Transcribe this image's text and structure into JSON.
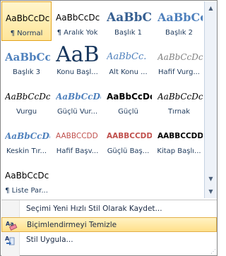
{
  "styles": [
    {
      "sample": "AaBbCcDc",
      "caption": "¶ Normal",
      "color": "#000000",
      "font": "sans",
      "size": 12,
      "weight": "normal",
      "italic": false,
      "selected": true
    },
    {
      "sample": "AaBbCcDc",
      "caption": "¶ Aralık Yok",
      "color": "#000000",
      "font": "sans",
      "size": 12,
      "weight": "normal",
      "italic": false,
      "selected": false
    },
    {
      "sample": "AaBbC",
      "caption": "Başlık 1",
      "color": "#365f91",
      "font": "serif",
      "size": 17,
      "weight": "bold",
      "italic": false,
      "selected": false
    },
    {
      "sample": "AaBbCc",
      "caption": "Başlık 2",
      "color": "#4f81bd",
      "font": "serif",
      "size": 16,
      "weight": "bold",
      "italic": false,
      "selected": false
    },
    {
      "sample": "AaBbCcI",
      "caption": "Başlık 3",
      "color": "#4f81bd",
      "font": "serif",
      "size": 15,
      "weight": "bold",
      "italic": false,
      "selected": false
    },
    {
      "sample": "AaB",
      "caption": "Konu Başl...",
      "color": "#17365d",
      "font": "serif",
      "size": 30,
      "weight": "normal",
      "italic": false,
      "selected": false
    },
    {
      "sample": "AaBbCc.",
      "caption": "Alt Konu ...",
      "color": "#4f81bd",
      "font": "serif",
      "size": 13,
      "weight": "normal",
      "italic": true,
      "selected": false
    },
    {
      "sample": "AaBbCcDc",
      "caption": "Hafif Vurg...",
      "color": "#808080",
      "font": "serif",
      "size": 12,
      "weight": "normal",
      "italic": true,
      "selected": false
    },
    {
      "sample": "AaBbCcDc",
      "caption": "Vurgu",
      "color": "#000000",
      "font": "serif",
      "size": 12,
      "weight": "normal",
      "italic": true,
      "selected": false
    },
    {
      "sample": "AaBbCcDc",
      "caption": "Güçlü Vur...",
      "color": "#4f81bd",
      "font": "serif",
      "size": 12,
      "weight": "bold",
      "italic": true,
      "selected": false
    },
    {
      "sample": "AaBbCcDc",
      "caption": "Güçlü",
      "color": "#000000",
      "font": "sans",
      "size": 12,
      "weight": "bold",
      "italic": false,
      "selected": false
    },
    {
      "sample": "AaBbCcDc",
      "caption": "Tırnak",
      "color": "#000000",
      "font": "serif",
      "size": 12,
      "weight": "normal",
      "italic": true,
      "selected": false
    },
    {
      "sample": "AaBbCcDc",
      "caption": "Keskin Tır...",
      "color": "#4f81bd",
      "font": "serif",
      "size": 12,
      "weight": "bold",
      "italic": true,
      "selected": false
    },
    {
      "sample": "AABBCCDD",
      "caption": "Hafif Başv...",
      "color": "#c0504d",
      "font": "sans",
      "size": 10.5,
      "weight": "normal",
      "italic": false,
      "selected": false
    },
    {
      "sample": "AABBCCDD",
      "caption": "Güçlü Baş...",
      "color": "#c0504d",
      "font": "sans",
      "size": 10.5,
      "weight": "bold",
      "italic": false,
      "selected": false
    },
    {
      "sample": "AABBCCDD",
      "caption": "Kitap Başlı...",
      "color": "#000000",
      "font": "sans",
      "size": 10.5,
      "weight": "bold",
      "italic": false,
      "selected": false
    },
    {
      "sample": "AaBbCcDc",
      "caption": "¶ Liste Par...",
      "color": "#000000",
      "font": "sans",
      "size": 12,
      "weight": "normal",
      "italic": false,
      "selected": false
    }
  ],
  "menu": {
    "save_quick_style": "Seçimi Yeni Hızlı Stil Olarak Kaydet...",
    "clear_formatting": "Biçimlendirmeyi Temizle",
    "apply_styles": "Stil Uygula..."
  },
  "colors": {
    "accent_hover": "#ffe08a",
    "border": "#868686",
    "caption_text": "#1e395b"
  },
  "icons": {
    "clear_formatting": "eraser-aa-icon",
    "apply_styles": "apply-styles-icon",
    "scroll_up": "chevron-up-icon",
    "scroll_down": "chevron-down-icon",
    "more": "more-options-icon",
    "resize": "resize-grip-icon"
  }
}
